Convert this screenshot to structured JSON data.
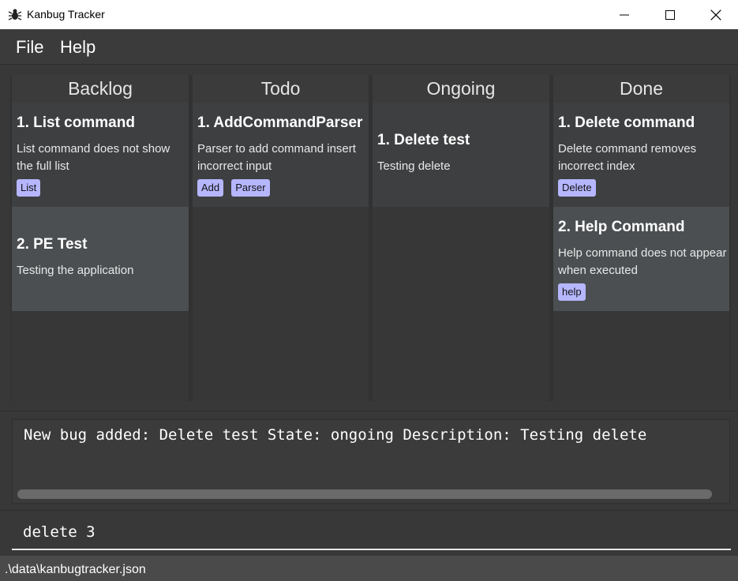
{
  "window": {
    "title": "Kanbug Tracker",
    "icon": "bug-icon"
  },
  "menu": {
    "items": [
      "File",
      "Help"
    ]
  },
  "board": {
    "columns": [
      {
        "header": "Backlog",
        "cards": [
          {
            "title": "1. List command",
            "description": "List command does not show the full list",
            "tags": [
              "List"
            ]
          },
          {
            "title": "2. PE Test",
            "description": "Testing the application",
            "tags": []
          }
        ]
      },
      {
        "header": "Todo",
        "cards": [
          {
            "title": "1. AddCommandParser",
            "description": "Parser to add command insert incorrect input",
            "tags": [
              "Add",
              "Parser"
            ]
          }
        ]
      },
      {
        "header": "Ongoing",
        "cards": [
          {
            "title": "1. Delete test",
            "description": "Testing delete",
            "tags": []
          }
        ]
      },
      {
        "header": "Done",
        "cards": [
          {
            "title": "1. Delete command",
            "description": "Delete command removes incorrect index",
            "tags": [
              "Delete"
            ]
          },
          {
            "title": "2. Help Command",
            "description": "Help command does not appear when executed",
            "tags": [
              "help"
            ]
          }
        ]
      }
    ]
  },
  "result_display": {
    "text": "New bug added: Delete test State: ongoing Description: Testing delete"
  },
  "command_box": {
    "value": "delete 3"
  },
  "status_bar": {
    "file_path": ".\\data\\kanbugtracker.json"
  },
  "colors": {
    "tag_background": "#b6b6ff",
    "card_dark": "#3e3f41",
    "card_light": "#4b4f51",
    "background": "#383838"
  }
}
